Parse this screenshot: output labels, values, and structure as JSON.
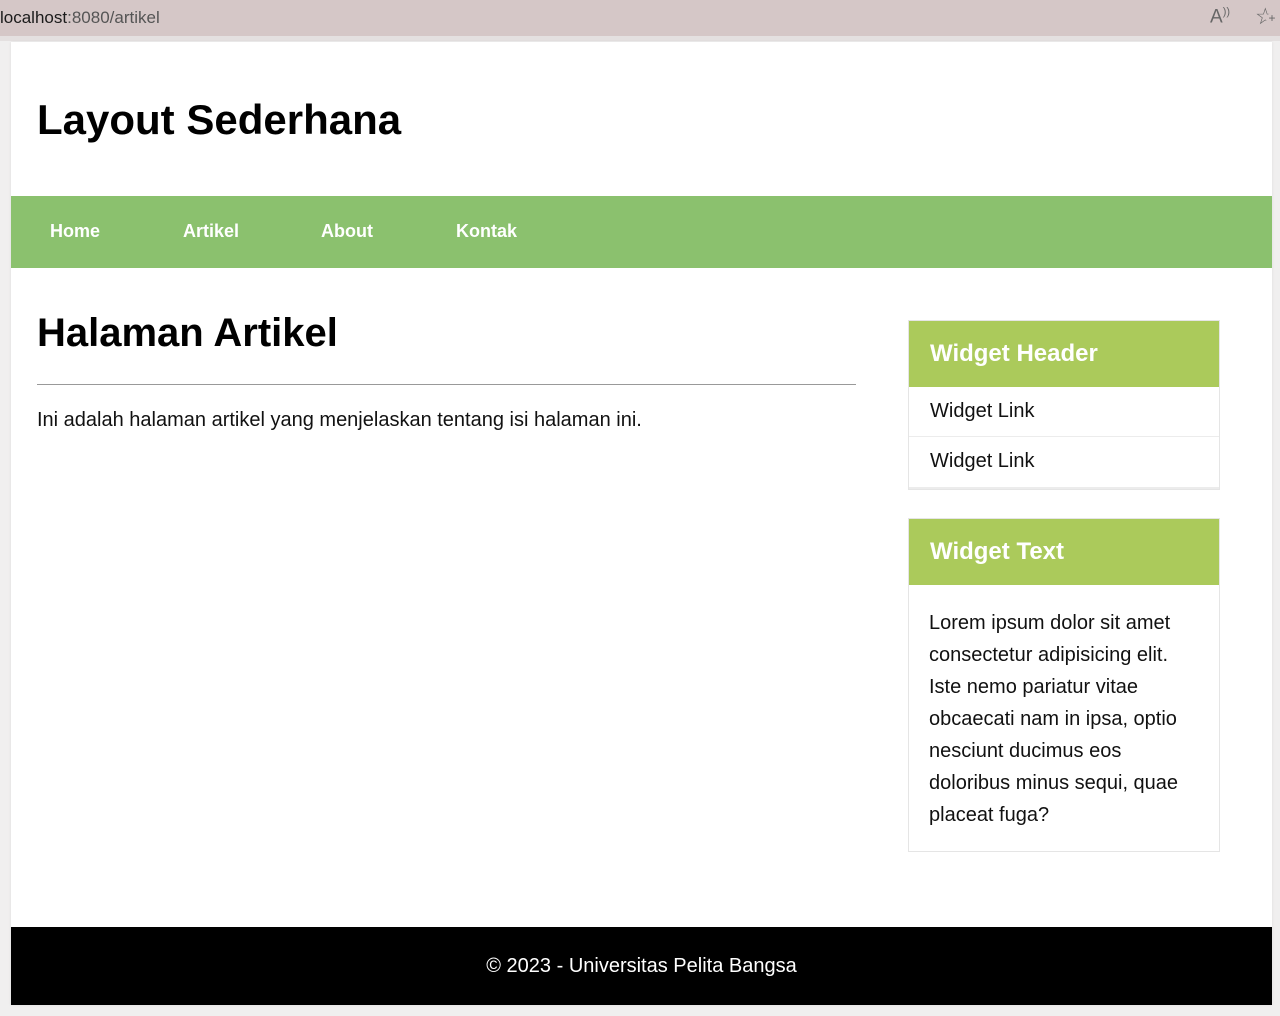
{
  "browser": {
    "url_host": "localhost",
    "url_rest": ":8080/artikel"
  },
  "site": {
    "title": "Layout Sederhana"
  },
  "nav": {
    "items": [
      {
        "label": "Home"
      },
      {
        "label": "Artikel"
      },
      {
        "label": "About"
      },
      {
        "label": "Kontak"
      }
    ]
  },
  "main": {
    "title": "Halaman Artikel",
    "text": "Ini adalah halaman artikel yang menjelaskan tentang isi halaman ini."
  },
  "sidebar": {
    "widget1": {
      "header": "Widget Header",
      "links": [
        {
          "label": "Widget Link"
        },
        {
          "label": "Widget Link"
        }
      ]
    },
    "widget2": {
      "header": "Widget Text",
      "text": "Lorem ipsum dolor sit amet consectetur adipisicing elit. Iste nemo pariatur vitae obcaecati nam in ipsa, optio nesciunt ducimus eos doloribus minus sequi, quae placeat fuga?"
    }
  },
  "footer": {
    "text": "© 2023 - Universitas Pelita Bangsa"
  },
  "colors": {
    "nav_bg": "#8bc16e",
    "widget_header_bg": "#abca5b",
    "footer_bg": "#000000"
  },
  "icons": {
    "read_aloud": "read-aloud-icon",
    "favorite": "add-favorite-icon"
  }
}
